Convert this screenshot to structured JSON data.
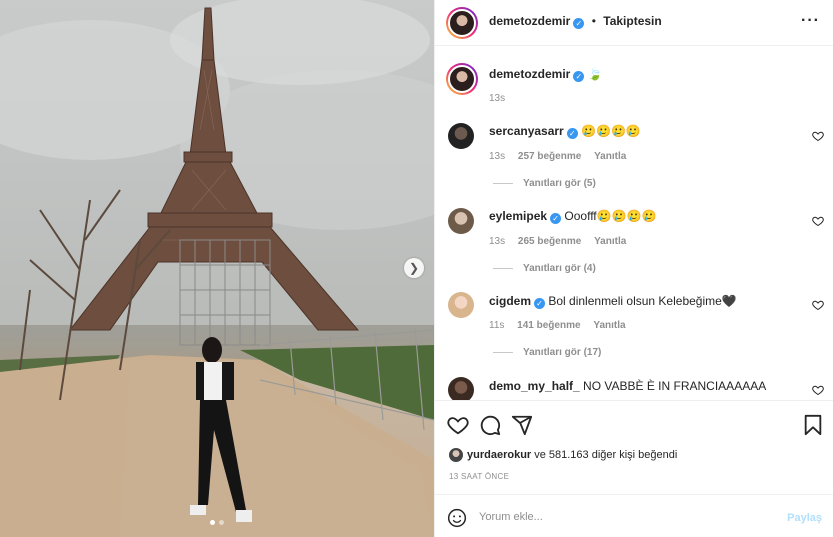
{
  "post": {
    "author": "demetozdemir",
    "follow_state": "Takiptesin",
    "separator": "•",
    "caption_emoji": "🍃",
    "caption_time": "13s"
  },
  "comments": [
    {
      "user": "sercanyasarr",
      "verified": true,
      "text": "🥲🥲🥲🥲",
      "time": "13s",
      "likes": "257 beğenme",
      "reply": "Yanıtla",
      "view_replies": "Yanıtları gör (5)"
    },
    {
      "user": "eylemipek",
      "verified": true,
      "text": "Ooofff🥲🥲🥲🥲",
      "time": "13s",
      "likes": "265 beğenme",
      "reply": "Yanıtla",
      "view_replies": "Yanıtları gör (4)"
    },
    {
      "user": "cigdem",
      "verified": true,
      "text": "Bol dinlenmeli olsun Kelebeğime🖤",
      "time": "11s",
      "likes": "141 beğenme",
      "reply": "Yanıtla",
      "view_replies": "Yanıtları gör (17)"
    },
    {
      "user": "demo_my_half_",
      "verified": false,
      "text": "NO VABBÈ È IN FRANCIAAAAAA"
    }
  ],
  "likes": {
    "user": "yurdaerokur",
    "rest": "ve 581.163 diğer kişi beğendi"
  },
  "posted_ago": "13 SAAT ÖNCE",
  "comment_box": {
    "placeholder": "Yorum ekle...",
    "post_label": "Paylaş"
  },
  "icons": {
    "more": "more-icon",
    "like": "heart-icon",
    "comment": "comment-icon",
    "share": "share-icon",
    "save": "bookmark-icon",
    "emoji": "emoji-icon",
    "next": "chevron-right-icon"
  },
  "colors": {
    "verified": "#3897f0",
    "post_button": "#b2dffc",
    "muted": "#8e8e8e"
  }
}
